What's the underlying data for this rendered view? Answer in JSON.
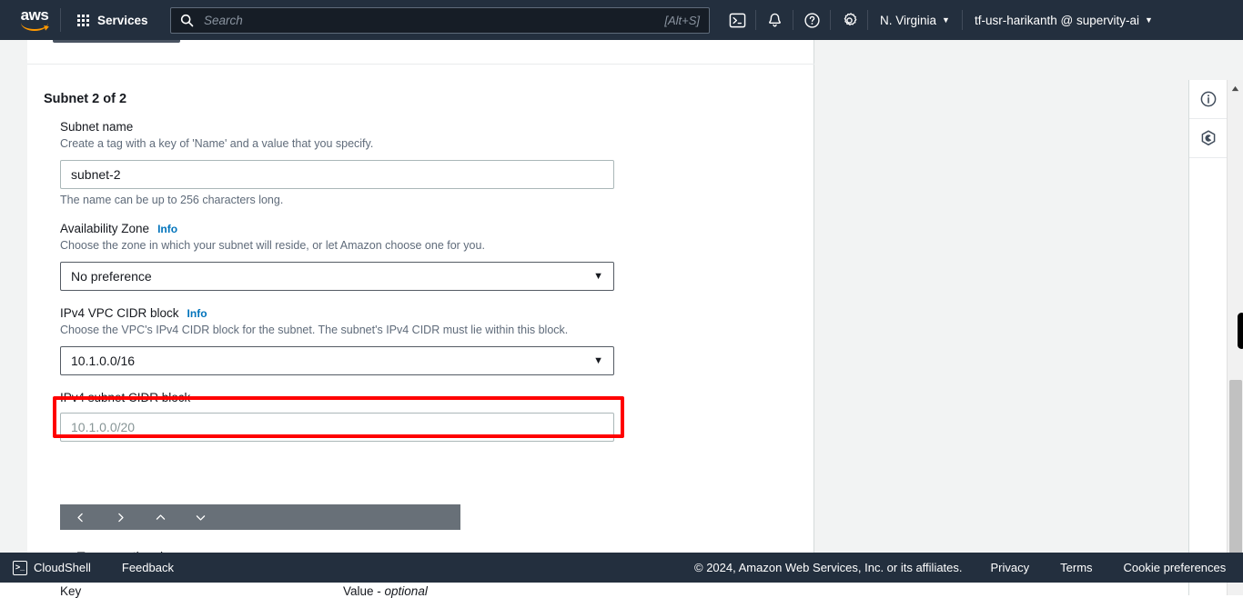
{
  "header": {
    "logo_alt": "aws",
    "services_label": "Services",
    "search_placeholder": "Search",
    "search_value": "",
    "search_shortcut": "[Alt+S]",
    "cloudshell_icon": "terminal-icon",
    "notifications_icon": "bell-icon",
    "help_icon": "question-circle-icon",
    "settings_icon": "gear-icon",
    "region": "N. Virginia",
    "account": "tf-usr-harikanth @ supervity-ai",
    "caret": "▼"
  },
  "main": {
    "section_title": "Subnet 2 of 2",
    "fields": {
      "subnet_name": {
        "label": "Subnet name",
        "description": "Create a tag with a key of 'Name' and a value that you specify.",
        "value": "subnet-2",
        "placeholder": "",
        "hint": "The name can be up to 256 characters long."
      },
      "availability_zone": {
        "label": "Availability Zone",
        "info": "Info",
        "description": "Choose the zone in which your subnet will reside, or let Amazon choose one for you.",
        "value": "No preference",
        "arrow": "▼"
      },
      "vpc_cidr": {
        "label": "IPv4 VPC CIDR block",
        "info": "Info",
        "description": "Choose the VPC's IPv4 CIDR block for the subnet. The subnet's IPv4 CIDR must lie within this block.",
        "value": "10.1.0.0/16",
        "arrow": "▼",
        "highlighted": true,
        "highlight_color": "#ff0000"
      },
      "subnet_cidr": {
        "label": "IPv4 subnet CIDR block",
        "value": "",
        "placeholder": "10.1.0.0/20"
      }
    },
    "mini_toolbar": {
      "prev_icon": "chevron-left-icon",
      "next_icon": "chevron-right-icon",
      "up_icon": "chevron-up-icon",
      "down_icon": "chevron-down-icon"
    },
    "tags": {
      "expander": "▼",
      "title": "Tags - ",
      "title_optional": "optional",
      "col_key": "Key",
      "col_value": "Value - ",
      "col_value_optional": "optional"
    }
  },
  "right_rail": {
    "info_icon": "info-circle-icon",
    "shield_icon": "hexagon-shield-icon"
  },
  "scrollbar": {
    "up_arrow": "▲"
  },
  "footer": {
    "cloudshell": "CloudShell",
    "feedback": "Feedback",
    "copyright": "© 2024, Amazon Web Services, Inc. or its affiliates.",
    "privacy": "Privacy",
    "terms": "Terms",
    "cookie_preferences": "Cookie preferences"
  },
  "colors": {
    "nav_bg": "#232f3e",
    "page_bg": "#f2f3f3",
    "link": "#0073bb",
    "accent_orange": "#ff9900",
    "annotation_red": "#ff0000",
    "toolbar_gray": "#687078"
  }
}
